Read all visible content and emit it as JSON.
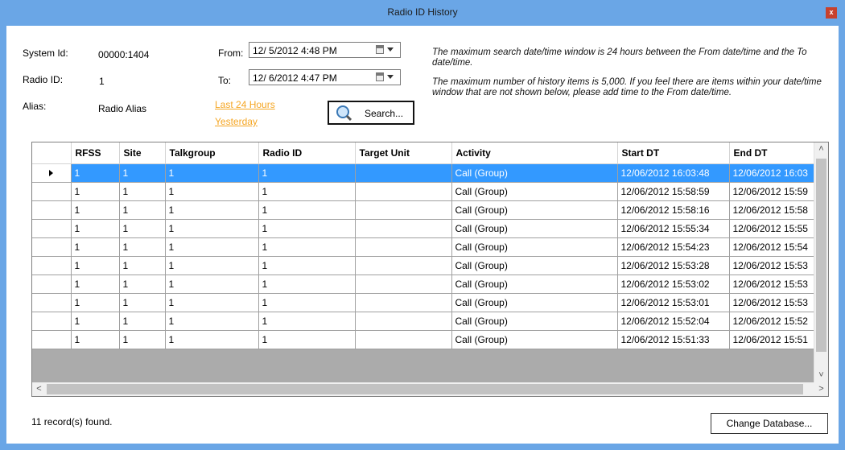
{
  "window": {
    "title": "Radio ID History",
    "close_glyph": "x"
  },
  "info_fields": [
    {
      "label": "System Id:",
      "value": "00000:1404"
    },
    {
      "label": "Radio ID:",
      "value": "1"
    },
    {
      "label": "Alias:",
      "value": "Radio Alias"
    }
  ],
  "date_range": {
    "from_label": "From:",
    "from_value": "12/ 5/2012  4:48 PM",
    "to_label": "To:",
    "to_value": "12/ 6/2012  4:47 PM"
  },
  "links": {
    "last_24": "Last 24 Hours",
    "yesterday": "Yesterday"
  },
  "search_button": "Search...",
  "notes": {
    "window": "The maximum search date/time window is 24 hours between the From date/time and the To date/time.",
    "limit": "The maximum number of history items is 5,000.  If you feel there are items within your date/time window that are not shown below, please add time to the From date/time."
  },
  "table": {
    "columns": [
      "RFSS",
      "Site",
      "Talkgroup",
      "Radio ID",
      "Target Unit",
      "Activity",
      "Start DT",
      "End DT"
    ],
    "rows": [
      [
        "1",
        "1",
        "1",
        "1",
        "",
        "Call (Group)",
        "12/06/2012 16:03:48",
        "12/06/2012 16:03"
      ],
      [
        "1",
        "1",
        "1",
        "1",
        "",
        "Call (Group)",
        "12/06/2012 15:58:59",
        "12/06/2012 15:59"
      ],
      [
        "1",
        "1",
        "1",
        "1",
        "",
        "Call (Group)",
        "12/06/2012 15:58:16",
        "12/06/2012 15:58"
      ],
      [
        "1",
        "1",
        "1",
        "1",
        "",
        "Call (Group)",
        "12/06/2012 15:55:34",
        "12/06/2012 15:55"
      ],
      [
        "1",
        "1",
        "1",
        "1",
        "",
        "Call (Group)",
        "12/06/2012 15:54:23",
        "12/06/2012 15:54"
      ],
      [
        "1",
        "1",
        "1",
        "1",
        "",
        "Call (Group)",
        "12/06/2012 15:53:28",
        "12/06/2012 15:53"
      ],
      [
        "1",
        "1",
        "1",
        "1",
        "",
        "Call (Group)",
        "12/06/2012 15:53:02",
        "12/06/2012 15:53"
      ],
      [
        "1",
        "1",
        "1",
        "1",
        "",
        "Call (Group)",
        "12/06/2012 15:53:01",
        "12/06/2012 15:53"
      ],
      [
        "1",
        "1",
        "1",
        "1",
        "",
        "Call (Group)",
        "12/06/2012 15:52:04",
        "12/06/2012 15:52"
      ],
      [
        "1",
        "1",
        "1",
        "1",
        "",
        "Call (Group)",
        "12/06/2012 15:51:33",
        "12/06/2012 15:51"
      ]
    ],
    "selected_row": 0
  },
  "status": "11 record(s) found.",
  "change_db_button": "Change Database...",
  "colors": {
    "frame": "#6aa6e6",
    "selection": "#3399ff",
    "link": "#f5a623",
    "close": "#c7412d"
  },
  "icons": [
    "close-icon",
    "calendar-icon",
    "dropdown-arrow-icon",
    "magnifier-icon",
    "row-pointer-icon",
    "scroll-arrow-icon"
  ]
}
